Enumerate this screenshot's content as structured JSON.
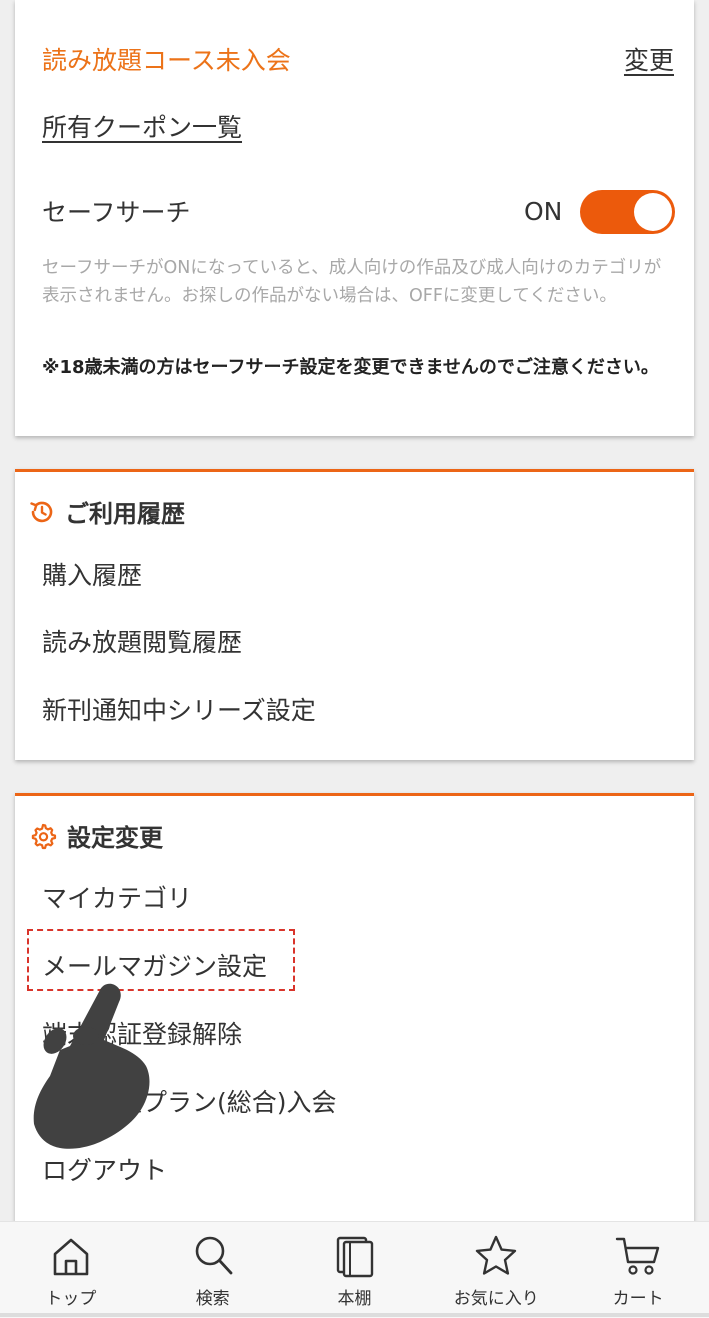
{
  "account": {
    "plan_status": "読み放題コース未入会",
    "change_label": "変更",
    "coupon_link": "所有クーポン一覧",
    "safe_search_label": "セーフサーチ",
    "safe_search_state": "ON",
    "safe_search_description": "セーフサーチがONになっていると、成人向けの作品及び成人向けのカテゴリが表示されません。お探しの作品がない場合は、OFFに変更してください。",
    "safe_search_note": "※18歳未満の方はセーフサーチ設定を変更できませんのでご注意ください。"
  },
  "history": {
    "title": "ご利用履歴",
    "items": [
      "購入履歴",
      "読み放題閲覧履歴",
      "新刊通知中シリーズ設定"
    ]
  },
  "settings": {
    "title": "設定変更",
    "items": [
      "マイカテゴリ",
      "メールマガジン設定",
      "端末認証登録解除",
      "読み放題プラン(総合)入会",
      "ログアウト"
    ]
  },
  "tabbar": {
    "items": [
      {
        "label": "トップ",
        "icon": "home-icon"
      },
      {
        "label": "検索",
        "icon": "search-icon"
      },
      {
        "label": "本棚",
        "icon": "bookshelf-icon"
      },
      {
        "label": "お気に入り",
        "icon": "star-icon"
      },
      {
        "label": "カート",
        "icon": "cart-icon"
      }
    ]
  },
  "colors": {
    "accent": "#ec6516",
    "plan_text": "#ec7319",
    "toggle_on": "#ec5a0c",
    "highlight_border": "#d9342b"
  }
}
